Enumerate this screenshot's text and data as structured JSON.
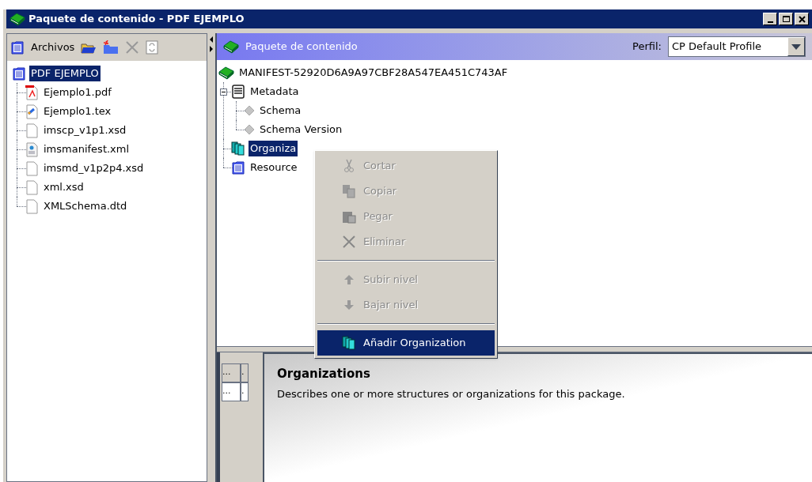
{
  "window": {
    "title": "Paquete de contenido - PDF EJEMPLO"
  },
  "files_panel": {
    "label": "Archivos",
    "tree": [
      {
        "label": "PDF EJEMPLO",
        "kind": "package",
        "selected": true,
        "children": [
          {
            "label": "Ejemplo1.pdf",
            "kind": "pdf",
            "selected": false
          },
          {
            "label": "Ejemplo1.tex",
            "kind": "tex",
            "selected": false
          },
          {
            "label": "imscp_v1p1.xsd",
            "kind": "file",
            "selected": false
          },
          {
            "label": "imsmanifest.xml",
            "kind": "xml",
            "selected": false
          },
          {
            "label": "imsmd_v1p2p4.xsd",
            "kind": "file",
            "selected": false
          },
          {
            "label": "xml.xsd",
            "kind": "file",
            "selected": false
          },
          {
            "label": "XMLSchema.dtd",
            "kind": "file",
            "selected": false
          }
        ]
      }
    ]
  },
  "package_panel": {
    "title": "Paquete de contenido",
    "profile_label": "Perfil:",
    "profile_value": "CP Default Profile",
    "tree": [
      {
        "label": "MANIFEST-52920D6A9A97CBF28A547EA451C743AF",
        "kind": "manifest",
        "selected": false,
        "children": [
          {
            "label": "Metadata",
            "kind": "metadata",
            "selected": false,
            "expanded": true,
            "children": [
              {
                "label": "Schema",
                "kind": "element",
                "selected": false
              },
              {
                "label": "Schema Version",
                "kind": "element",
                "selected": false
              }
            ]
          },
          {
            "label": "Organiza",
            "kind": "organizations",
            "selected": true
          },
          {
            "label": "Resource",
            "kind": "resources",
            "selected": false
          }
        ]
      }
    ]
  },
  "context_menu": [
    {
      "kind": "item",
      "label": "Cortar",
      "disabled": true,
      "selected": false
    },
    {
      "kind": "item",
      "label": "Copiar",
      "disabled": true,
      "selected": false
    },
    {
      "kind": "item",
      "label": "Pegar",
      "disabled": true,
      "selected": false
    },
    {
      "kind": "item",
      "label": "Eliminar",
      "disabled": true,
      "selected": false
    },
    {
      "kind": "separator"
    },
    {
      "kind": "item",
      "label": "Subir nivel",
      "disabled": true,
      "selected": false
    },
    {
      "kind": "item",
      "label": "Bajar nivel",
      "disabled": true,
      "selected": false
    },
    {
      "kind": "separator"
    },
    {
      "kind": "item",
      "label": "Añadir Organization",
      "disabled": false,
      "selected": true
    }
  ],
  "properties_grid": [
    [
      "...",
      "."
    ],
    [
      "...",
      "."
    ]
  ],
  "description": {
    "title": "Organizations",
    "text": "Describes one or more structures or organizations for this package."
  }
}
